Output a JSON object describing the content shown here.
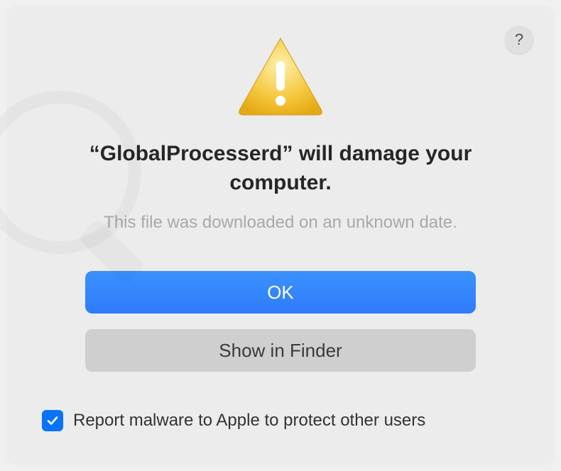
{
  "dialog": {
    "title": "“GlobalProcesserd” will damage your computer.",
    "subtitle": "This file was downloaded on an unknown date.",
    "primary_button": "OK",
    "secondary_button": "Show in Finder",
    "checkbox_label": "Report malware to Apple to protect other users",
    "checkbox_checked": true,
    "help_label": "?"
  },
  "icons": {
    "warning": "warning-triangle-icon",
    "help": "help-icon",
    "checkmark": "checkmark-icon"
  },
  "colors": {
    "primary": "#2f7bfb",
    "background": "#ececec",
    "text": "#262626",
    "secondary_text": "#a9a9a9"
  }
}
